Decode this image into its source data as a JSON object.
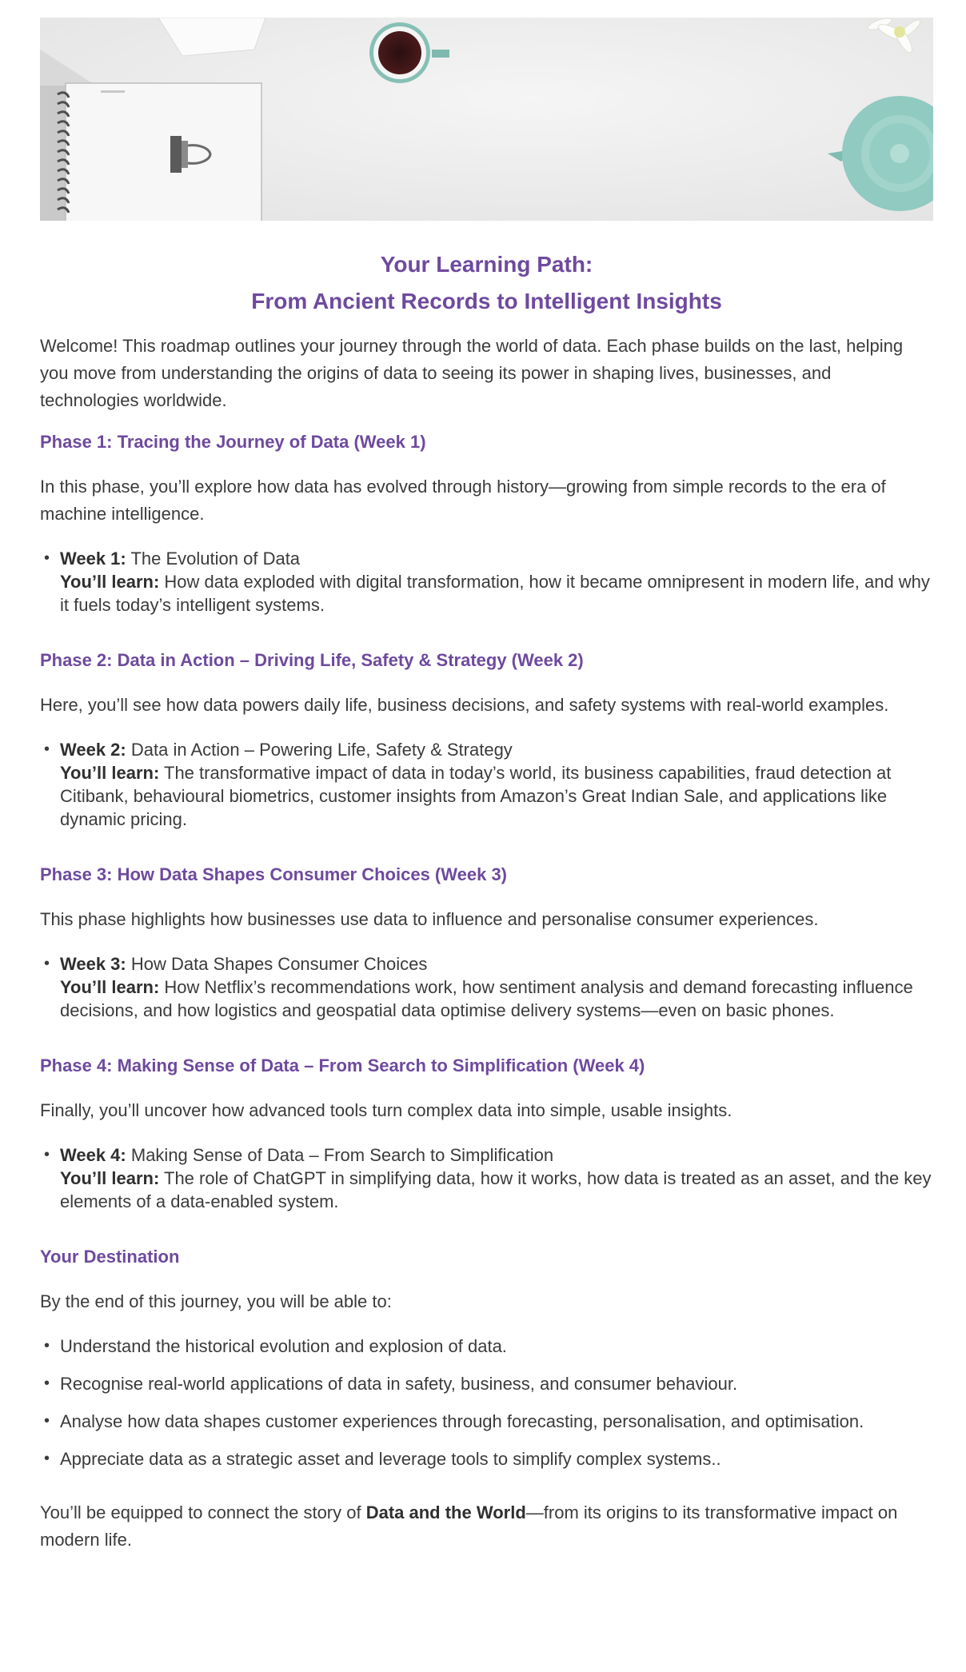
{
  "title": {
    "line1": "Your Learning Path:",
    "line2": "From Ancient Records to Intelligent Insights"
  },
  "intro": "Welcome! This roadmap outlines your journey through the world of data. Each phase builds on the last, helping you move from understanding the origins of data to seeing its power in shaping lives, businesses, and technologies worldwide.",
  "phases": [
    {
      "heading": "Phase 1: Tracing the Journey of Data (Week 1)",
      "description": "In this phase, you’ll explore how data has evolved through history—growing from simple records to the era of machine intelligence.",
      "week_label": "Week 1:",
      "week_title": "The Evolution of Data",
      "learn_label": "You’ll learn:",
      "learn_text": "How data exploded with digital transformation, how it became omnipresent in modern life, and why it fuels today’s intelligent systems."
    },
    {
      "heading": "Phase 2: Data in Action – Driving Life, Safety & Strategy (Week 2)",
      "description": "Here, you’ll see how data powers daily life, business decisions, and safety systems with real-world examples.",
      "week_label": "Week 2:",
      "week_title": "Data in Action – Powering Life, Safety & Strategy",
      "learn_label": "You’ll learn:",
      "learn_text": "The transformative impact of data in today’s world, its business capabilities, fraud detection at Citibank, behavioural biometrics, customer insights from Amazon’s Great Indian Sale, and applications like dynamic pricing."
    },
    {
      "heading": "Phase 3: How Data Shapes Consumer Choices (Week 3)",
      "description": "This phase highlights how businesses use data to influence and personalise consumer experiences.",
      "week_label": "Week 3:",
      "week_title": "How Data Shapes Consumer Choices",
      "learn_label": "You’ll learn:",
      "learn_text": "How Netflix’s recommendations work, how sentiment analysis and demand forecasting influence decisions, and how logistics and geospatial data optimise delivery systems—even on basic phones."
    },
    {
      "heading": "Phase 4: Making Sense of Data – From Search to Simplification (Week 4)",
      "description": "Finally, you’ll uncover how advanced tools turn complex data into simple, usable insights.",
      "week_label": "Week 4:",
      "week_title": "Making Sense of Data – From Search to Simplification",
      "learn_label": "You’ll learn:",
      "learn_text": "The role of ChatGPT in simplifying data, how it works, how data is treated as an asset, and the key elements of a data-enabled system."
    }
  ],
  "destination": {
    "heading": "Your Destination",
    "lead": "By the end of this journey, you will be able to:",
    "items": [
      "Understand the historical evolution and explosion of data.",
      "Recognise real-world applications of data in safety, business, and consumer behaviour.",
      "Analyse how data shapes customer experiences through forecasting, personalisation, and optimisation.",
      "Appreciate data as a strategic asset and leverage tools to simplify complex systems.."
    ]
  },
  "outro": {
    "before": "You’ll be equipped to connect the story of ",
    "bold": "Data and the World",
    "after": "—from its origins to its transformative impact on modern life."
  },
  "colors": {
    "heading": "#6e4a9e",
    "body_text": "#3b3b3b",
    "teapot": "#8fc9c0"
  },
  "hero_icons": [
    "notebook-icon",
    "binder-clip-icon",
    "coffee-cup-icon",
    "teapot-icon",
    "flower-icon",
    "paper-sheet-icon"
  ]
}
